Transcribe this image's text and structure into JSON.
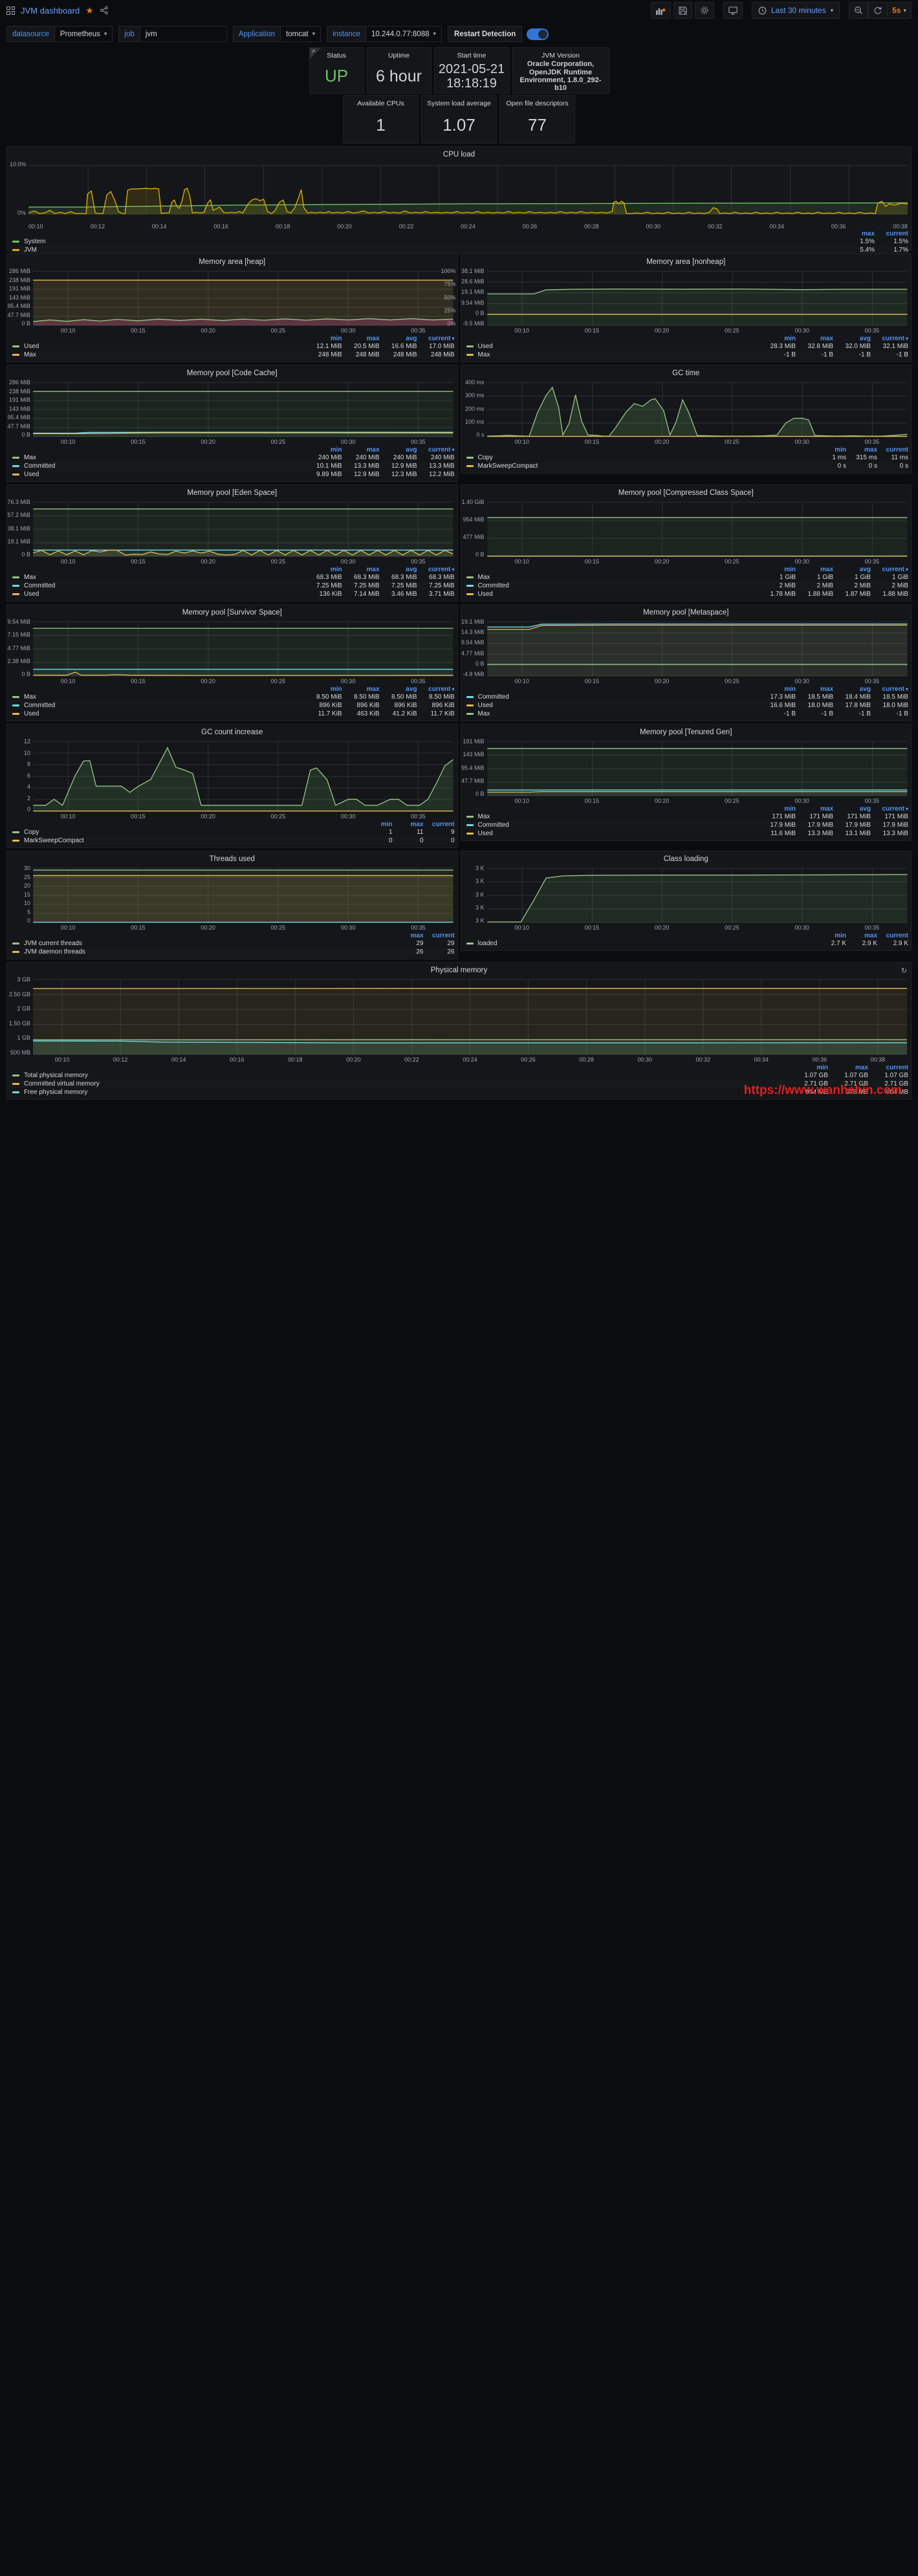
{
  "topnav": {
    "dashboard_title": "JVM dashboard",
    "icons": [
      "grid-icon",
      "star-icon",
      "share-icon"
    ],
    "buttons": [
      {
        "name": "add-panel-button",
        "glyph": "▐█▌"
      },
      {
        "name": "save-dashboard-button",
        "glyph": "💾"
      },
      {
        "name": "dashboard-settings-button",
        "glyph": "⚙"
      },
      {
        "name": "tv-mode-button",
        "glyph": "🖥"
      }
    ],
    "time_range": "Last 30 minutes",
    "zoom_out_label": "⊖",
    "refresh_interval": "5s"
  },
  "variables": [
    {
      "label": "datasource",
      "value": "Prometheus",
      "type": "select"
    },
    {
      "label": "job",
      "value": "jvm",
      "type": "textbox"
    },
    {
      "label": "Application",
      "value": "tomcat",
      "type": "select"
    },
    {
      "label": "instance",
      "value": "10.244.0.77:8088",
      "type": "select"
    }
  ],
  "restart_detection": {
    "label": "Restart Detection",
    "enabled": true
  },
  "stats_row1": [
    {
      "title": "Status",
      "value": "UP",
      "color": "#73bf69",
      "size": 26,
      "width": 85
    },
    {
      "title": "Uptime",
      "value": "6 hour",
      "color": "#cfd3d8",
      "size": 26,
      "width": 100
    },
    {
      "title": "Start time",
      "value": "2021-05-21 18:18:19",
      "color": "#cfd3d8",
      "size": 24,
      "width": 117
    },
    {
      "title": "JVM Version",
      "value": "Oracle Corporation, OpenJDK Runtime Environment, 1.8.0_292-b10",
      "color": "#cfd3d8",
      "size": 13,
      "width": 140
    }
  ],
  "stats_row2": [
    {
      "title": "Available CPUs",
      "value": "1",
      "color": "#cfd3d8",
      "size": 26,
      "width": 117
    },
    {
      "title": "System load average",
      "value": "1.07",
      "color": "#cfd3d8",
      "size": 26,
      "width": 117
    },
    {
      "title": "Open file descriptors",
      "value": "77",
      "color": "#cfd3d8",
      "size": 26,
      "width": 117
    }
  ],
  "chart_data": [
    {
      "id": "cpu-load",
      "type": "line",
      "title": "CPU load",
      "ylabel": "",
      "xlabel": "",
      "yticks": [
        "0%",
        "10.0%"
      ],
      "ylim": [
        0,
        10
      ],
      "xticks": [
        "00:10",
        "00:12",
        "00:14",
        "00:16",
        "00:18",
        "00:20",
        "00:22",
        "00:24",
        "00:26",
        "00:28",
        "00:30",
        "00:32",
        "00:34",
        "00:36",
        "00:38"
      ],
      "legend_columns": [
        "max",
        "current"
      ],
      "series": [
        {
          "name": "System",
          "color": "#73bf69",
          "values": [
            "1.5%",
            "1.5%"
          ]
        },
        {
          "name": "JVM",
          "color": "#e0b400",
          "values": [
            "5.4%",
            "1.7%"
          ]
        }
      ]
    },
    {
      "id": "memory-area-heap",
      "type": "area",
      "title": "Memory area [heap]",
      "yticks": [
        "0 B",
        "47.7 MiB",
        "95.4 MiB",
        "143 MiB",
        "191 MiB",
        "238 MiB",
        "286 MiB"
      ],
      "yticks_right": [
        "0%",
        "25%",
        "50%",
        "75%",
        "100%"
      ],
      "xticks": [
        "00:10",
        "00:15",
        "00:20",
        "00:25",
        "00:30",
        "00:35"
      ],
      "legend_columns": [
        "min",
        "max",
        "avg",
        "current"
      ],
      "series": [
        {
          "name": "Used",
          "color": "#9ac48a",
          "values": [
            "12.1 MiB",
            "20.5 MiB",
            "16.6 MiB",
            "17.0 MiB"
          ]
        },
        {
          "name": "Max",
          "color": "#e5bc52",
          "values": [
            "248 MiB",
            "248 MiB",
            "248 MiB",
            "248 MiB"
          ]
        }
      ]
    },
    {
      "id": "memory-area-nonheap",
      "type": "area",
      "title": "Memory area [nonheap]",
      "yticks": [
        "-9.5 MiB",
        "0 B",
        "9.54 MiB",
        "19.1 MiB",
        "28.6 MiB",
        "38.1 MiB"
      ],
      "xticks": [
        "00:10",
        "00:15",
        "00:20",
        "00:25",
        "00:30",
        "00:35"
      ],
      "legend_columns": [
        "min",
        "max",
        "avg",
        "current"
      ],
      "series": [
        {
          "name": "Used",
          "color": "#9ac48a",
          "values": [
            "28.3 MiB",
            "32.8 MiB",
            "32.0 MiB",
            "32.1 MiB"
          ]
        },
        {
          "name": "Max",
          "color": "#e5bc52",
          "values": [
            "-1 B",
            "-1 B",
            "-1 B",
            "-1 B"
          ]
        }
      ]
    },
    {
      "id": "memory-pool-code-cache",
      "type": "area",
      "title": "Memory pool [Code Cache]",
      "yticks": [
        "0 B",
        "47.7 MiB",
        "95.4 MiB",
        "143 MiB",
        "191 MiB",
        "238 MiB",
        "286 MiB"
      ],
      "xticks": [
        "00:10",
        "00:15",
        "00:20",
        "00:25",
        "00:30",
        "00:35"
      ],
      "legend_columns": [
        "min",
        "max",
        "avg",
        "current"
      ],
      "series": [
        {
          "name": "Max",
          "color": "#9ac48a",
          "values": [
            "240 MiB",
            "240 MiB",
            "240 MiB",
            "240 MiB"
          ]
        },
        {
          "name": "Committed",
          "color": "#70dbed",
          "values": [
            "10.1 MiB",
            "13.3 MiB",
            "12.9 MiB",
            "13.3 MiB"
          ]
        },
        {
          "name": "Used",
          "color": "#e5bc52",
          "values": [
            "9.89 MiB",
            "12.9 MiB",
            "12.3 MiB",
            "12.2 MiB"
          ]
        }
      ]
    },
    {
      "id": "gc-time",
      "type": "area",
      "title": "GC time",
      "yticks": [
        "0 s",
        "100 ms",
        "200 ms",
        "300 ms",
        "400 ms"
      ],
      "xticks": [
        "00:10",
        "00:15",
        "00:20",
        "00:25",
        "00:30",
        "00:35"
      ],
      "legend_columns": [
        "min",
        "max",
        "current"
      ],
      "series": [
        {
          "name": "Copy",
          "color": "#9ac48a",
          "values": [
            "1 ms",
            "315 ms",
            "11 ms"
          ]
        },
        {
          "name": "MarkSweepCompact",
          "color": "#e5bc52",
          "values": [
            "0 s",
            "0 s",
            "0 s"
          ]
        }
      ]
    },
    {
      "id": "memory-pool-eden-space",
      "type": "area",
      "title": "Memory pool [Eden Space]",
      "yticks": [
        "0 B",
        "19.1 MiB",
        "38.1 MiB",
        "57.2 MiB",
        "76.3 MiB"
      ],
      "xticks": [
        "00:10",
        "00:15",
        "00:20",
        "00:25",
        "00:30",
        "00:35"
      ],
      "legend_columns": [
        "min",
        "max",
        "avg",
        "current"
      ],
      "series": [
        {
          "name": "Max",
          "color": "#9ac48a",
          "values": [
            "68.3 MiB",
            "68.3 MiB",
            "68.3 MiB",
            "68.3 MiB"
          ]
        },
        {
          "name": "Committed",
          "color": "#70dbed",
          "values": [
            "7.25 MiB",
            "7.25 MiB",
            "7.25 MiB",
            "7.25 MiB"
          ]
        },
        {
          "name": "Used",
          "color": "#e5bc52",
          "values": [
            "136 KiB",
            "7.14 MiB",
            "3.46 MiB",
            "3.71 MiB"
          ]
        }
      ]
    },
    {
      "id": "memory-pool-compressed-class-space",
      "type": "area",
      "title": "Memory pool [Compressed Class Space]",
      "yticks": [
        "0 B",
        "477 MiB",
        "954 MiB",
        "1.40 GiB"
      ],
      "xticks": [
        "00:10",
        "00:15",
        "00:20",
        "00:25",
        "00:30",
        "00:35"
      ],
      "legend_columns": [
        "min",
        "max",
        "avg",
        "current"
      ],
      "series": [
        {
          "name": "Max",
          "color": "#9ac48a",
          "values": [
            "1 GiB",
            "1 GiB",
            "1 GiB",
            "1 GiB"
          ]
        },
        {
          "name": "Committed",
          "color": "#70dbed",
          "values": [
            "2 MiB",
            "2 MiB",
            "2 MiB",
            "2 MiB"
          ]
        },
        {
          "name": "Used",
          "color": "#e5bc52",
          "values": [
            "1.78 MiB",
            "1.88 MiB",
            "1.87 MiB",
            "1.88 MiB"
          ]
        }
      ]
    },
    {
      "id": "memory-pool-survivor-space",
      "type": "area",
      "title": "Memory pool [Survivor Space]",
      "yticks": [
        "0 B",
        "2.38 MiB",
        "4.77 MiB",
        "7.15 MiB",
        "9.54 MiB"
      ],
      "xticks": [
        "00:10",
        "00:15",
        "00:20",
        "00:25",
        "00:30",
        "00:35"
      ],
      "legend_columns": [
        "min",
        "max",
        "avg",
        "current"
      ],
      "series": [
        {
          "name": "Max",
          "color": "#9ac48a",
          "values": [
            "8.50 MiB",
            "8.50 MiB",
            "8.50 MiB",
            "8.50 MiB"
          ]
        },
        {
          "name": "Committed",
          "color": "#70dbed",
          "values": [
            "896 KiB",
            "896 KiB",
            "896 KiB",
            "896 KiB"
          ]
        },
        {
          "name": "Used",
          "color": "#e5bc52",
          "values": [
            "11.7 KiB",
            "463 KiB",
            "41.2 KiB",
            "11.7 KiB"
          ]
        }
      ]
    },
    {
      "id": "memory-pool-metaspace",
      "type": "area",
      "title": "Memory pool [Metaspace]",
      "yticks": [
        "-4.8 MiB",
        "0 B",
        "4.77 MiB",
        "9.54 MiB",
        "14.3 MiB",
        "19.1 MiB"
      ],
      "xticks": [
        "00:10",
        "00:15",
        "00:20",
        "00:25",
        "00:30",
        "00:35"
      ],
      "legend_columns": [
        "min",
        "max",
        "avg",
        "current"
      ],
      "series": [
        {
          "name": "Committed",
          "color": "#70dbed",
          "values": [
            "17.3 MiB",
            "18.5 MiB",
            "18.4 MiB",
            "18.5 MiB"
          ]
        },
        {
          "name": "Used",
          "color": "#e5bc52",
          "values": [
            "16.6 MiB",
            "18.0 MiB",
            "17.8 MiB",
            "18.0 MiB"
          ]
        },
        {
          "name": "Max",
          "color": "#9ac48a",
          "values": [
            "-1 B",
            "-1 B",
            "-1 B",
            "-1 B"
          ]
        }
      ]
    },
    {
      "id": "gc-count-increase",
      "type": "area",
      "title": "GC count increase",
      "yticks": [
        "0",
        "2",
        "4",
        "6",
        "8",
        "10",
        "12"
      ],
      "xticks": [
        "00:10",
        "00:15",
        "00:20",
        "00:25",
        "00:30",
        "00:35"
      ],
      "legend_columns": [
        "min",
        "max",
        "current"
      ],
      "series": [
        {
          "name": "Copy",
          "color": "#9ac48a",
          "values": [
            "1",
            "11",
            "9"
          ]
        },
        {
          "name": "MarkSweepCompact",
          "color": "#e5bc52",
          "values": [
            "0",
            "0",
            "0"
          ]
        }
      ]
    },
    {
      "id": "memory-pool-tenured-gen",
      "type": "area",
      "title": "Memory pool [Tenured Gen]",
      "yticks": [
        "0 B",
        "47.7 MiB",
        "95.4 MiB",
        "143 MiB",
        "191 MiB"
      ],
      "xticks": [
        "00:10",
        "00:15",
        "00:20",
        "00:25",
        "00:30",
        "00:35"
      ],
      "legend_columns": [
        "min",
        "max",
        "avg",
        "current"
      ],
      "series": [
        {
          "name": "Max",
          "color": "#9ac48a",
          "values": [
            "171 MiB",
            "171 MiB",
            "171 MiB",
            "171 MiB"
          ]
        },
        {
          "name": "Committed",
          "color": "#70dbed",
          "values": [
            "17.9 MiB",
            "17.9 MiB",
            "17.9 MiB",
            "17.9 MiB"
          ]
        },
        {
          "name": "Used",
          "color": "#e5bc52",
          "values": [
            "11.6 MiB",
            "13.3 MiB",
            "13.1 MiB",
            "13.3 MiB"
          ]
        }
      ]
    },
    {
      "id": "threads-used",
      "type": "area",
      "title": "Threads used",
      "yticks": [
        "0",
        "5",
        "10",
        "15",
        "20",
        "25",
        "30"
      ],
      "xticks": [
        "00:10",
        "00:15",
        "00:20",
        "00:25",
        "00:30",
        "00:35"
      ],
      "legend_columns": [
        "max",
        "current"
      ],
      "series": [
        {
          "name": "JVM current threads",
          "color": "#9ac48a",
          "values": [
            "29",
            "29"
          ]
        },
        {
          "name": "JVM daemon threads",
          "color": "#e5bc52",
          "values": [
            "26",
            "26"
          ]
        }
      ]
    },
    {
      "id": "class-loading",
      "type": "area",
      "title": "Class loading",
      "yticks": [
        "3 K",
        "3 K",
        "3 K",
        "3 K",
        "3 K"
      ],
      "xticks": [
        "00:10",
        "00:15",
        "00:20",
        "00:25",
        "00:30",
        "00:35"
      ],
      "legend_columns": [
        "min",
        "max",
        "current"
      ],
      "series": [
        {
          "name": "loaded",
          "color": "#9ac48a",
          "values": [
            "2.7 K",
            "2.9 K",
            "2.9 K"
          ]
        }
      ]
    },
    {
      "id": "physical-memory",
      "type": "area",
      "title": "Physical memory",
      "yticks": [
        "500 MB",
        "1 GB",
        "1.50 GB",
        "2 GB",
        "2.50 GB",
        "3 GB"
      ],
      "xticks": [
        "00:10",
        "00:12",
        "00:14",
        "00:16",
        "00:18",
        "00:20",
        "00:22",
        "00:24",
        "00:26",
        "00:28",
        "00:30",
        "00:32",
        "00:34",
        "00:36",
        "00:38"
      ],
      "legend_columns": [
        "min",
        "max",
        "current"
      ],
      "series": [
        {
          "name": "Total physical memory",
          "color": "#9ac48a",
          "values": [
            "1.07 GB",
            "1.07 GB",
            "1.07 GB"
          ]
        },
        {
          "name": "Committed virtual memory",
          "color": "#e5bc52",
          "values": [
            "2.71 GB",
            "2.71 GB",
            "2.71 GB"
          ]
        },
        {
          "name": "Free physical memory",
          "color": "#70dbed",
          "values": [
            "964 MB",
            "978 MB",
            "964 MB"
          ]
        }
      ]
    }
  ],
  "watermark": "https://www.wanhebin.com"
}
